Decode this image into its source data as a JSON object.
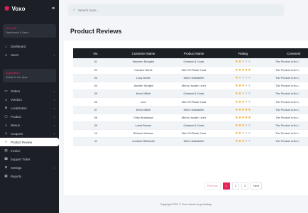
{
  "brand": {
    "logo": "✱",
    "name": "Voxo",
    "menu_icon": "≡"
  },
  "sidebar": {
    "group1": {
      "title": "General",
      "subtitle": "Dashboards & Users"
    },
    "group1_items": [
      {
        "label": "Dashboard",
        "icon": "⌂",
        "chevron": ""
      },
      {
        "label": "Users",
        "icon": "☺",
        "chevron": "›"
      }
    ],
    "group2": {
      "title": "Application",
      "subtitle": "Ready To Use Apps"
    },
    "group2_items": [
      {
        "label": "Orders",
        "icon": "▭",
        "chevron": "›"
      },
      {
        "label": "Vendors",
        "icon": "☺",
        "chevron": "›"
      },
      {
        "label": "Localization",
        "icon": "⊕",
        "chevron": "›"
      },
      {
        "label": "Product",
        "icon": "▢",
        "chevron": "›"
      },
      {
        "label": "Menus",
        "icon": "≡",
        "chevron": "›"
      },
      {
        "label": "Coupons",
        "icon": "◇",
        "chevron": "›"
      },
      {
        "label": "Product Review",
        "icon": "☆",
        "chevron": ""
      },
      {
        "label": "Invoice",
        "icon": "▤",
        "chevron": ""
      },
      {
        "label": "Support Ticket",
        "icon": "☎",
        "chevron": ""
      },
      {
        "label": "Settings",
        "icon": "⚙",
        "chevron": "›"
      },
      {
        "label": "Reports",
        "icon": "▦",
        "chevron": ""
      }
    ]
  },
  "search": {
    "icon": "⌕",
    "placeholder": "Search Voxo..."
  },
  "page": {
    "title": "Product Reviews"
  },
  "table": {
    "headers": [
      "No.",
      "Customer Name",
      "Product Name",
      "Rating",
      "Comment"
    ],
    "rows": [
      {
        "no": "01",
        "customer": "Maureen Biologist",
        "product": "Outwear & Coats",
        "rating": 2,
        "comment": "The Product is No L"
      },
      {
        "no": "02",
        "customer": "Caroline Harris",
        "product": "Slim Fit Plastic Coat",
        "rating": 5,
        "comment": "The Product is No L"
      },
      {
        "no": "03",
        "customer": "Lucy Morile",
        "product": "Men's Sweatshirt",
        "rating": 1,
        "comment": "The Product is No L"
      },
      {
        "no": "04",
        "customer": "Jennifer Straight",
        "product": "Men's Hoodie t-shirt",
        "rating": 3,
        "comment": "The Product is No L"
      },
      {
        "no": "05",
        "customer": "Kevin Millett",
        "product": "Outwear & Coats",
        "rating": 2,
        "comment": "The Product is No L"
      },
      {
        "no": "06",
        "customer": "czxc",
        "product": "Slim Fit Plastic Coat",
        "rating": 3,
        "comment": "The Product is No L"
      },
      {
        "no": "07",
        "customer": "Kevin Millett",
        "product": "Men's Sweatshirt",
        "rating": 5,
        "comment": "The Product is No L"
      },
      {
        "no": "08",
        "customer": "Dillon Bradshaw",
        "product": "Men's Hoodie t-shirt",
        "rating": 5,
        "comment": "The Product is No L"
      },
      {
        "no": "09",
        "customer": "Lorna Bonner",
        "product": "Outwear & Coats",
        "rating": 3,
        "comment": "The Product is No L"
      },
      {
        "no": "10",
        "customer": "Richard Johnson",
        "product": "Slim Fit Plastic Coat",
        "rating": 2,
        "comment": "The Product is No L"
      },
      {
        "no": "11",
        "customer": "Lorraine McDowell",
        "product": "Men's Sweatshirt",
        "rating": 3,
        "comment": "The Product is No L"
      }
    ]
  },
  "pagination": {
    "previous": "Previous",
    "pages": [
      "1",
      "2",
      "3"
    ],
    "current": "1",
    "next": "Next"
  },
  "footer": {
    "text": "Copyright 2021 © Voxo theme by pixelstrap"
  },
  "colors": {
    "accent": "#e8235a",
    "sidebar_bg": "#1c1f26",
    "star_on": "#f5a623",
    "star_off": "#c8ccd2"
  },
  "icons": {
    "star": "★"
  }
}
